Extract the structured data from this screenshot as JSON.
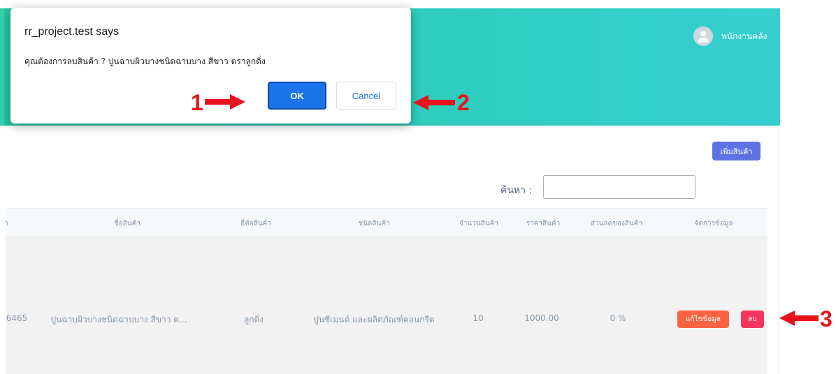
{
  "header": {
    "user_name": "พนักงานคลัง",
    "accent": "#2ecdbe"
  },
  "page": {
    "add_button_label": "เพิ่มสินค้า",
    "search_label": "ค้นหา :",
    "search_value": ""
  },
  "table": {
    "columns": [
      "า",
      "ชื่อสินค้า",
      "ยี่ห้อสินค้า",
      "ชนิดสินค้า",
      "จำนวนสินค้า",
      "ราคาสินค้า",
      "ส่วนลดของสินค้า",
      "จัดการข้อมูล"
    ],
    "rows": [
      {
        "code": "6465",
        "name": "ปูนฉาบผิวบางชนิดฉาบบาง สีขาว ต...",
        "brand": "ลูกดิ่ง",
        "type": "ปูนซีเมนต์ และผลิตภัณฑ์คอนกรีต",
        "qty": "10",
        "price": "1000.00",
        "discount": "0 %",
        "edit_label": "แก้ไขข้อมูล",
        "delete_label": "ลบ"
      }
    ]
  },
  "dialog": {
    "title": "rr_project.test says",
    "message": "คุณต้องการลบสินค้า ? ปูนฉาบผิวบางชนิดฉาบบาง สีขาว ตราลูกดิ่ง",
    "ok_label": "OK",
    "cancel_label": "Cancel"
  },
  "annotations": {
    "label_1": "1",
    "label_2": "2",
    "label_3": "3",
    "color": "#e8121c"
  }
}
